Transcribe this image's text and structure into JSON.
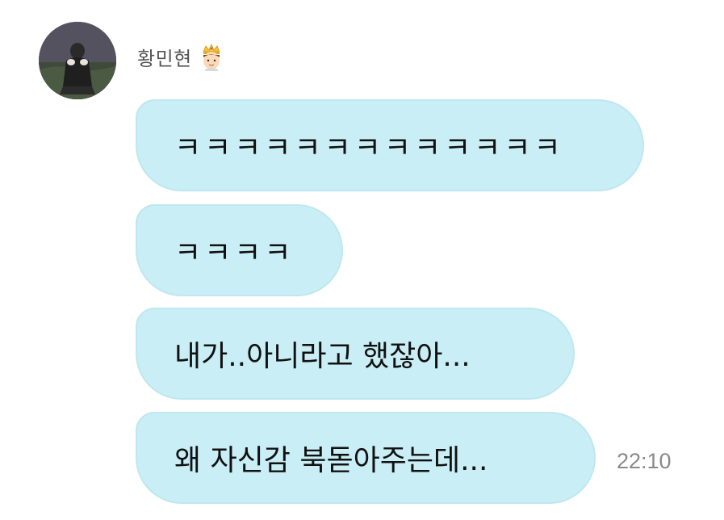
{
  "sender": {
    "name": "황민현",
    "badge_icon": "crown-prince-emoji-icon"
  },
  "messages": [
    {
      "text": "ㅋㅋㅋㅋㅋㅋㅋㅋㅋㅋㅋㅋㅋ"
    },
    {
      "text": "ㅋㅋㅋㅋ"
    },
    {
      "text": "내가..아니라고 했잖아..."
    },
    {
      "text": "왜 자신감 북돋아주는데..."
    }
  ],
  "timestamp": "22:10",
  "colors": {
    "bubble_bg": "#c9eef5",
    "name_text": "#555555",
    "timestamp_text": "#8a8a8a",
    "message_text": "#111111"
  }
}
